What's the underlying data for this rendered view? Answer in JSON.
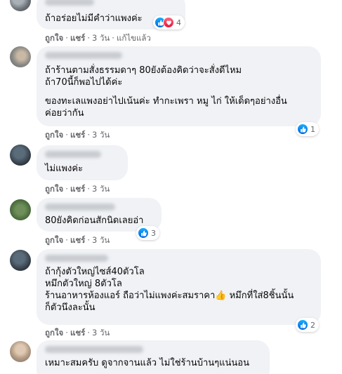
{
  "comments": [
    {
      "text": "ถ้าอร่อยไม่มีคำว่าแพงค่ะ",
      "reactions": [
        "like-icon",
        "love-icon"
      ],
      "reaction_count": "4",
      "actions": {
        "like": "ถูกใจ",
        "reply": "แชร์",
        "time": "3 วัน",
        "edited": "แก้ไขแล้ว"
      }
    },
    {
      "paragraph1": "ถ้าร้านตามสั่งธรรมดาๆ 80ยังต้องคิดว่าจะสั่งดีไหม\nถ้า70นี้ก็พอไปได้ค่ะ",
      "paragraph2": "ของทะเลแพงอย่าไปเน้นค่ะ ทำกะเพรา หมู ไก่ ให้เด็ดๆอย่างอื่น\nค่อยว่ากัน",
      "reactions": [
        "like-icon"
      ],
      "reaction_count": "1",
      "actions": {
        "like": "ถูกใจ",
        "reply": "แชร์",
        "time": "3 วัน"
      }
    },
    {
      "text": "ไม่แพงค่ะ",
      "actions": {
        "like": "ถูกใจ",
        "reply": "แชร์",
        "time": "3 วัน"
      }
    },
    {
      "text": "80ยังคิดก่อนสักนิดเลยอ่า",
      "reactions": [
        "like-icon"
      ],
      "reaction_count": "3",
      "actions": {
        "like": "ถูกใจ",
        "reply": "แชร์",
        "time": "3 วัน"
      }
    },
    {
      "line1": "ถ้ากุ้งตัวใหญ่ไซส์40ตัวโล",
      "line2": "หมึกตัวใหญ่ 8ตัวโล",
      "line3a": "ร้านอาหารห้องแอร์ ถือว่าไม่แพงค่ะสมราคา",
      "line3_emoji": "👍",
      "line3b": " หมึกที่ใส่8ชิ้นนั้น",
      "line4": "ก็ตัวนึงละนั้น",
      "reactions": [
        "like-icon"
      ],
      "reaction_count": "2",
      "actions": {
        "like": "ถูกใจ",
        "reply": "แชร์",
        "time": "3 วัน"
      }
    },
    {
      "text": "เหมาะสมครับ ดูจากจานแล้ว ไม่ใช่ร้านบ้านๆแน่นอน"
    }
  ]
}
